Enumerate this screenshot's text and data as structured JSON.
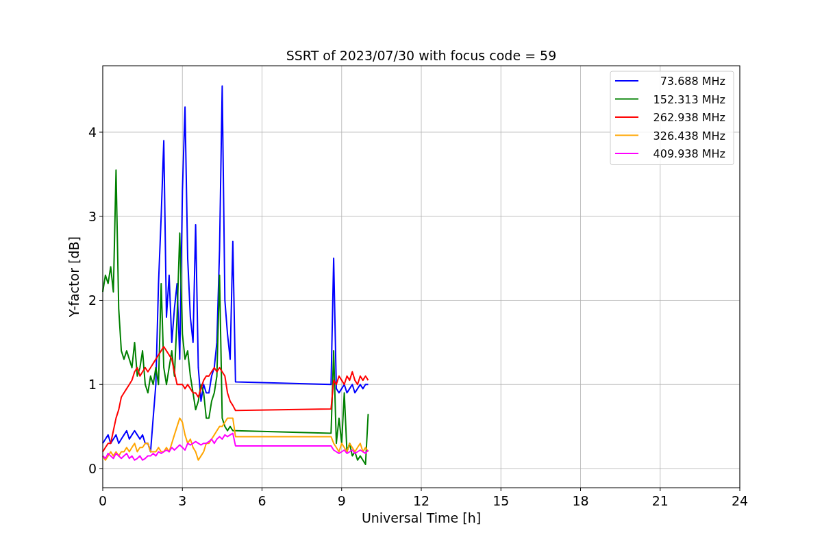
{
  "chart_data": {
    "type": "line",
    "title": "SSRT of 2023/07/30 with focus code = 59",
    "xlabel": "Universal Time [h]",
    "ylabel": "Y-factor [dB]",
    "x": [
      0,
      0.1,
      0.2,
      0.3,
      0.4,
      0.5,
      0.6,
      0.7,
      0.8,
      0.9,
      1,
      1.1,
      1.2,
      1.3,
      1.4,
      1.5,
      1.6,
      1.7,
      1.8,
      1.9,
      2,
      2.1,
      2.2,
      2.3,
      2.4,
      2.5,
      2.6,
      2.7,
      2.8,
      2.9,
      3,
      3.1,
      3.2,
      3.3,
      3.4,
      3.5,
      3.6,
      3.7,
      3.8,
      3.9,
      4,
      4.1,
      4.2,
      4.3,
      4.4,
      4.5,
      4.6,
      4.7,
      4.8,
      4.9,
      5,
      8.6,
      8.7,
      8.8,
      8.9,
      9,
      9.1,
      9.2,
      9.3,
      9.4,
      9.5,
      9.6,
      9.7,
      9.8,
      9.9,
      10
    ],
    "series": [
      {
        "name": "73.688 MHz",
        "color": "#0000ff",
        "values": [
          0.3,
          0.35,
          0.4,
          0.3,
          0.35,
          0.4,
          0.3,
          0.35,
          0.4,
          0.45,
          0.35,
          0.4,
          0.45,
          0.4,
          0.35,
          0.4,
          0.3,
          0.3,
          0.2,
          0.6,
          1.0,
          2.2,
          3.0,
          3.9,
          1.8,
          2.3,
          1.5,
          1.9,
          2.2,
          1.3,
          3.3,
          4.3,
          2.5,
          1.8,
          1.5,
          2.9,
          1.2,
          0.8,
          1.0,
          0.9,
          0.9,
          1.1,
          1.2,
          1.5,
          2.6,
          4.55,
          2.0,
          1.6,
          1.3,
          2.7,
          1.03,
          1.0,
          2.5,
          0.95,
          0.9,
          0.95,
          1.0,
          0.9,
          0.95,
          1.0,
          0.9,
          0.95,
          1.0,
          0.95,
          1.0,
          1.0
        ]
      },
      {
        "name": "152.313 MHz",
        "color": "#008000",
        "values": [
          2.1,
          2.3,
          2.2,
          2.4,
          2.1,
          3.55,
          1.9,
          1.4,
          1.3,
          1.4,
          1.3,
          1.2,
          1.5,
          1.1,
          1.2,
          1.4,
          1.0,
          0.9,
          1.1,
          1.0,
          1.2,
          1.0,
          2.2,
          1.2,
          1.0,
          1.2,
          1.4,
          1.1,
          1.8,
          2.8,
          1.6,
          1.3,
          1.4,
          1.1,
          0.9,
          0.7,
          0.8,
          1.0,
          0.9,
          0.6,
          0.6,
          0.8,
          0.9,
          1.1,
          2.3,
          0.6,
          0.5,
          0.45,
          0.5,
          0.45,
          0.45,
          0.42,
          1.4,
          0.3,
          0.6,
          0.3,
          0.9,
          0.2,
          0.3,
          0.15,
          0.2,
          0.1,
          0.15,
          0.1,
          0.05,
          0.65
        ]
      },
      {
        "name": "262.938 MHz",
        "color": "#ff0000",
        "values": [
          0.2,
          0.25,
          0.3,
          0.3,
          0.45,
          0.6,
          0.7,
          0.85,
          0.9,
          0.95,
          1.0,
          1.05,
          1.15,
          1.2,
          1.1,
          1.15,
          1.2,
          1.15,
          1.2,
          1.25,
          1.3,
          1.35,
          1.4,
          1.45,
          1.4,
          1.35,
          1.3,
          1.15,
          1.0,
          1.0,
          1.0,
          0.95,
          1.0,
          0.95,
          0.9,
          0.9,
          0.85,
          0.95,
          1.05,
          1.1,
          1.1,
          1.15,
          1.2,
          1.15,
          1.2,
          1.15,
          1.1,
          0.9,
          0.8,
          0.75,
          0.69,
          0.71,
          1.05,
          1.0,
          1.1,
          1.05,
          1.0,
          1.1,
          1.05,
          1.15,
          1.05,
          1.0,
          1.1,
          1.05,
          1.1,
          1.05
        ]
      },
      {
        "name": "326.438 MHz",
        "color": "#ffa500",
        "values": [
          0.15,
          0.1,
          0.15,
          0.2,
          0.15,
          0.2,
          0.15,
          0.2,
          0.2,
          0.25,
          0.2,
          0.25,
          0.3,
          0.2,
          0.25,
          0.25,
          0.3,
          0.3,
          0.2,
          0.2,
          0.2,
          0.25,
          0.2,
          0.2,
          0.25,
          0.2,
          0.3,
          0.4,
          0.5,
          0.6,
          0.55,
          0.4,
          0.3,
          0.35,
          0.25,
          0.2,
          0.1,
          0.15,
          0.2,
          0.3,
          0.3,
          0.35,
          0.4,
          0.45,
          0.5,
          0.5,
          0.55,
          0.6,
          0.6,
          0.6,
          0.38,
          0.38,
          0.3,
          0.25,
          0.2,
          0.3,
          0.25,
          0.2,
          0.3,
          0.25,
          0.2,
          0.25,
          0.3,
          0.2,
          0.25,
          0.2
        ]
      },
      {
        "name": "409.938 MHz",
        "color": "#ff00ff",
        "values": [
          0.15,
          0.12,
          0.18,
          0.15,
          0.12,
          0.18,
          0.15,
          0.12,
          0.15,
          0.18,
          0.12,
          0.15,
          0.1,
          0.12,
          0.15,
          0.1,
          0.12,
          0.15,
          0.15,
          0.18,
          0.15,
          0.2,
          0.18,
          0.2,
          0.22,
          0.2,
          0.25,
          0.22,
          0.25,
          0.28,
          0.25,
          0.22,
          0.3,
          0.28,
          0.3,
          0.32,
          0.3,
          0.28,
          0.3,
          0.3,
          0.32,
          0.35,
          0.3,
          0.35,
          0.38,
          0.35,
          0.4,
          0.38,
          0.4,
          0.42,
          0.27,
          0.27,
          0.22,
          0.2,
          0.18,
          0.2,
          0.22,
          0.18,
          0.2,
          0.22,
          0.18,
          0.2,
          0.22,
          0.2,
          0.18,
          0.22
        ]
      }
    ],
    "xlim": [
      0,
      24
    ],
    "ylim": [
      -0.228,
      4.79
    ],
    "xticks": [
      0,
      3,
      6,
      9,
      12,
      15,
      18,
      21,
      24
    ],
    "yticks": [
      0,
      1,
      2,
      3,
      4
    ],
    "grid": true,
    "legend": true
  }
}
